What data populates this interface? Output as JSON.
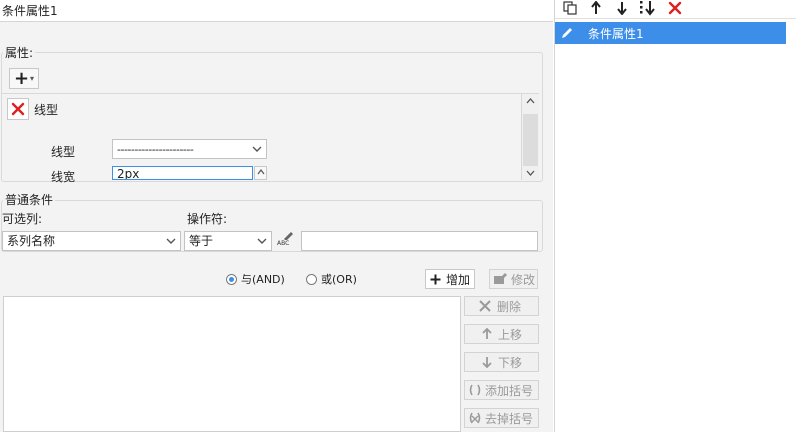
{
  "left": {
    "name_value": "条件属性1",
    "property": {
      "legend": "属性:",
      "add_glyph": "+",
      "dropdown_glyph": "▾",
      "item_title": "线型",
      "line_type_label": "线型",
      "line_type_value": "----------------------",
      "line_width_label": "线宽",
      "line_width_value": "2px"
    },
    "condition": {
      "legend": "普通条件",
      "optional_label": "可选列:",
      "operator_label": "操作符:",
      "column_value": "系列名称",
      "operator_value": "等于",
      "value_text": "",
      "value_icon_text": "ABC"
    },
    "logic": {
      "and_label": "与(AND)",
      "or_label": "或(OR)",
      "selected": "and"
    },
    "buttons": {
      "add": "增加",
      "modify": "修改",
      "delete": "删除",
      "move_up": "上移",
      "move_down": "下移",
      "add_bracket": "添加括号",
      "remove_bracket": "去掉括号"
    }
  },
  "right": {
    "list_items": [
      "条件属性1"
    ]
  },
  "colors": {
    "accent": "#3d8ee8",
    "danger": "#e02020"
  }
}
